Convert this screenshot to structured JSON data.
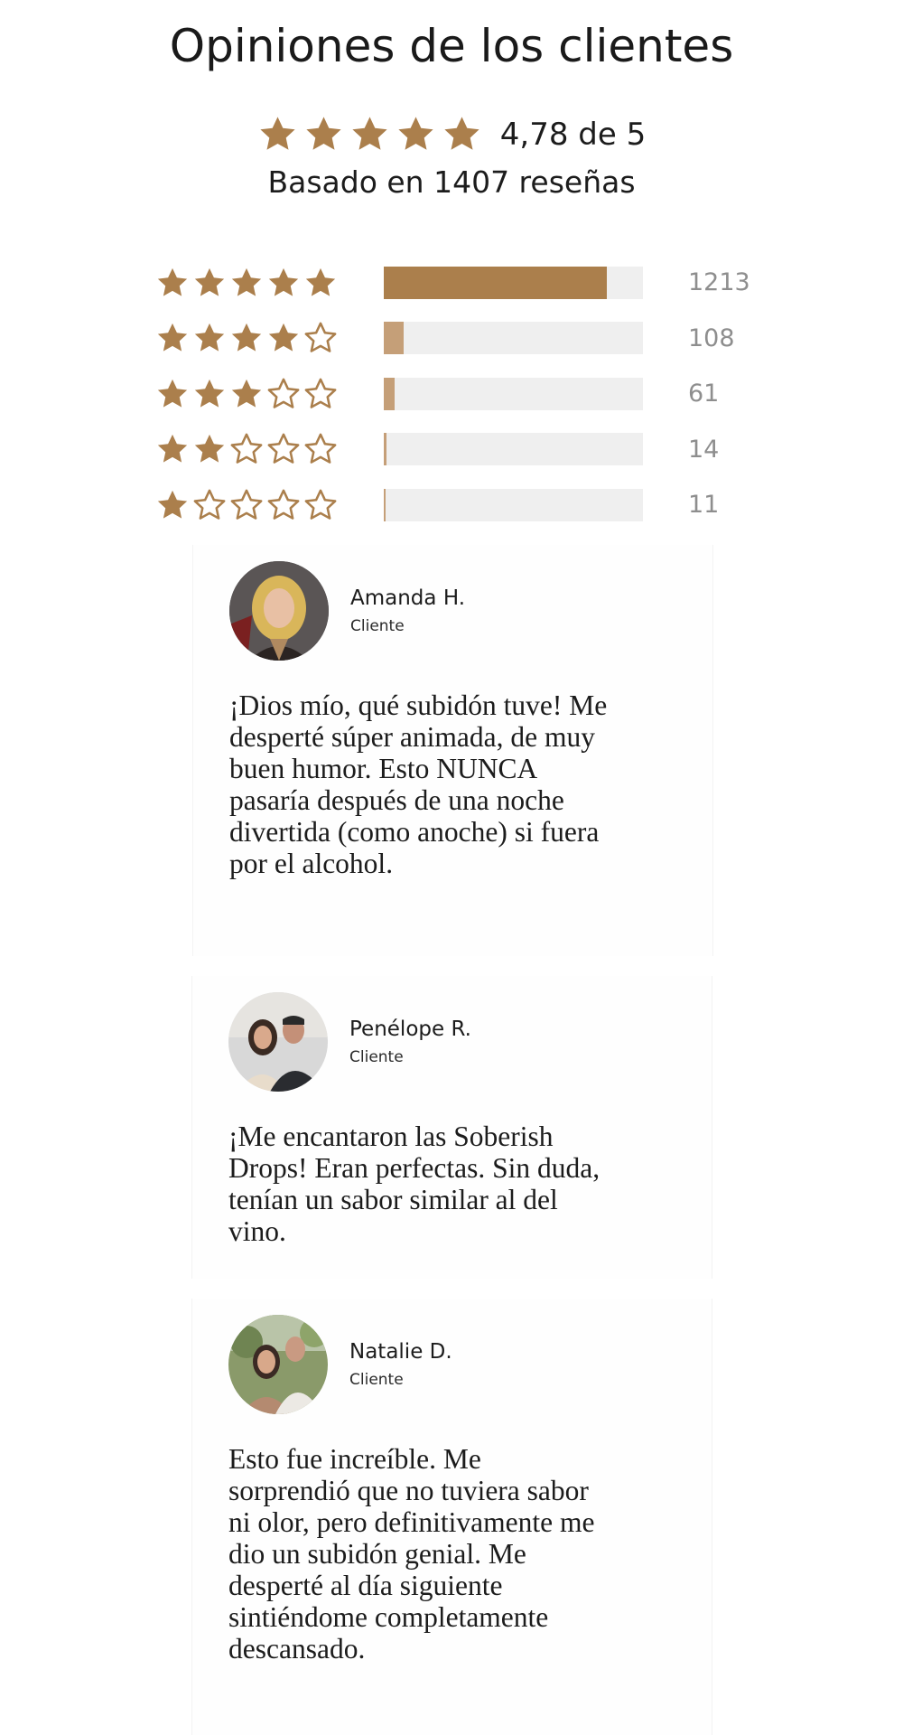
{
  "header": {
    "title": "Opiniones de los clientes",
    "average_text": "4,78 de 5",
    "average_rating": 4.78,
    "based_on_text": "Basado en 1407 reseñas"
  },
  "colors": {
    "star_gold": "#ab7f4c",
    "bar_fill_strong": "#ab7f4c",
    "bar_fill_light": "#c59f78",
    "bar_track": "#efefef",
    "count_gray": "#8e8e8e"
  },
  "breakdown": [
    {
      "stars": 5,
      "count": "1213",
      "fraction": 0.862
    },
    {
      "stars": 4,
      "count": "108",
      "fraction": 0.077
    },
    {
      "stars": 3,
      "count": "61",
      "fraction": 0.043
    },
    {
      "stars": 2,
      "count": "14",
      "fraction": 0.01
    },
    {
      "stars": 1,
      "count": "11",
      "fraction": 0.008
    }
  ],
  "reviews": [
    {
      "name": "Amanda H.",
      "role": "Cliente",
      "text": "¡Dios mío, qué subidón tuve! Me desperté súper animada, de muy buen humor. Esto NUNCA pasaría después de una noche divertida (como anoche) si fuera por el alcohol."
    },
    {
      "name": "Penélope R.",
      "role": "Cliente",
      "text": "¡Me encantaron las Soberish Drops! Eran perfectas. Sin duda, tenían un sabor similar al del vino."
    },
    {
      "name": "Natalie D.",
      "role": "Cliente",
      "text": "Esto fue increíble. Me sorprendió que no tuviera sabor ni olor, pero definitivamente me dio un subidón genial. Me desperté al día siguiente sintiéndome completamente descansado."
    }
  ]
}
